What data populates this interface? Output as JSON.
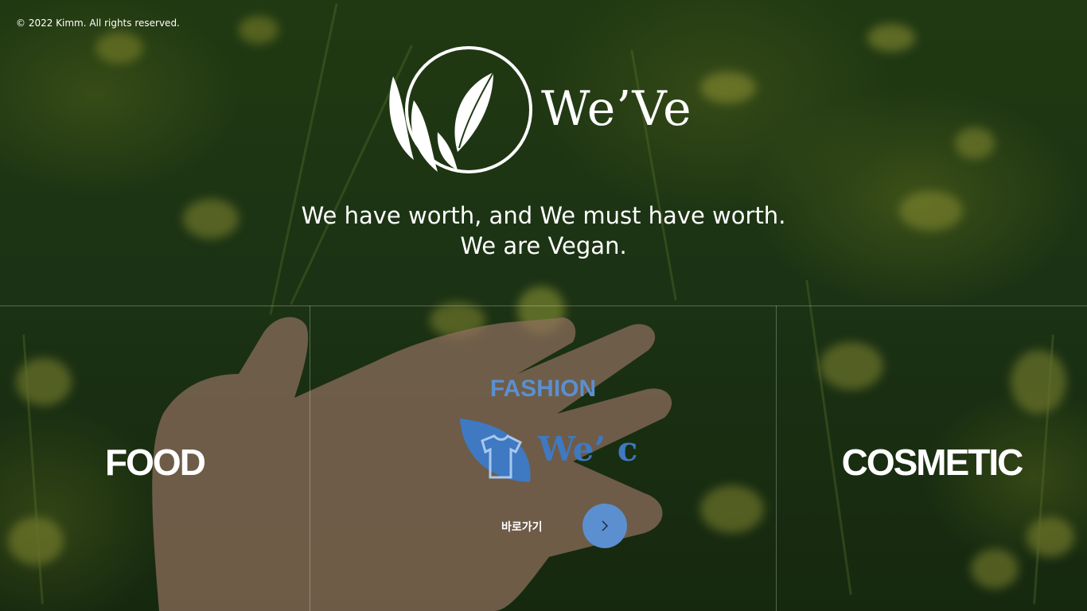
{
  "footer": {
    "copyright": "© 2022 Kimm. All rights reserved."
  },
  "brand": {
    "name": "We’Ve",
    "logo_icon": "leaf-circle-icon"
  },
  "hero": {
    "tagline_line1": "We have worth, and We must have worth.",
    "tagline_line2": "We are Vegan."
  },
  "categories": [
    {
      "label": "FOOD"
    },
    {
      "label": "FASHION",
      "sub_brand": "We’ c",
      "sub_brand_icon": "tshirt-leaf-icon",
      "link_label": "바로가기",
      "link_icon": "chevron-right-icon",
      "accent_color": "#5b8fd0"
    },
    {
      "label": "COSMETIC"
    }
  ]
}
